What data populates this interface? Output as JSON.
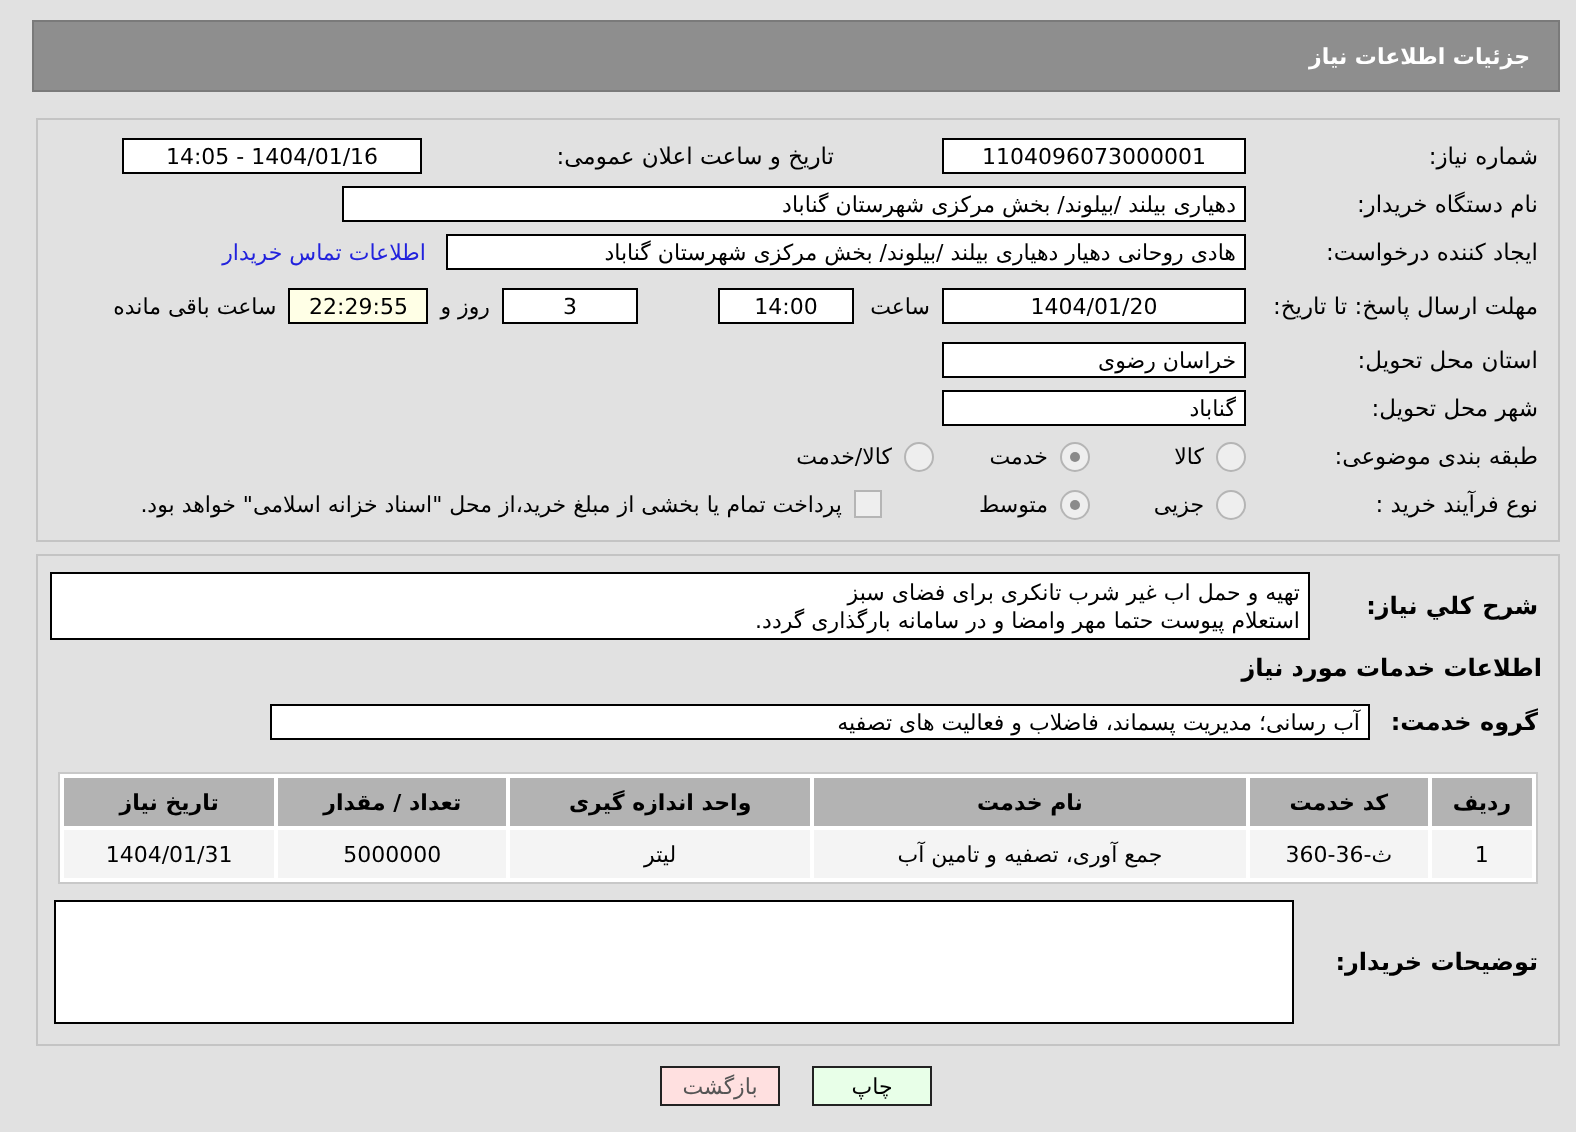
{
  "header": {
    "title": "جزئیات اطلاعات نیاز"
  },
  "need_number": {
    "label": "شماره نیاز:",
    "value": "1104096073000001"
  },
  "announce": {
    "label": "تاریخ و ساعت اعلان عمومی:",
    "value": "1404/01/16 - 14:05"
  },
  "buyer": {
    "label": "نام دستگاه خریدار:",
    "value": "دهیاری بیلند /بیلوند/ بخش مرکزی شهرستان گناباد"
  },
  "creator": {
    "label": "ایجاد کننده درخواست:",
    "value": "هادی روحانی دهیار دهیاری بیلند /بیلوند/ بخش مرکزی شهرستان گناباد",
    "link": "اطلاعات تماس خریدار"
  },
  "deadline": {
    "label": "مهلت ارسال پاسخ: تا تاریخ:",
    "date": "1404/01/20",
    "time_label": "ساعت",
    "time": "14:00",
    "days": "3",
    "days_label": "روز و",
    "remaining": "22:29:55",
    "remaining_label": "ساعت باقی مانده"
  },
  "province": {
    "label": "استان محل تحویل:",
    "value": "خراسان رضوی"
  },
  "city": {
    "label": "شهر محل تحویل:",
    "value": "گناباد"
  },
  "category": {
    "label": "طبقه بندی موضوعی:",
    "options": [
      {
        "label": "کالا",
        "selected": false
      },
      {
        "label": "خدمت",
        "selected": true
      },
      {
        "label": "کالا/خدمت",
        "selected": false
      }
    ]
  },
  "purchase_type": {
    "label": "نوع فرآیند خرید :",
    "options": [
      {
        "label": "جزیی",
        "selected": false
      },
      {
        "label": "متوسط",
        "selected": true
      }
    ],
    "payment": {
      "label": "پرداخت تمام یا بخشی از مبلغ خرید،از محل \"اسناد خزانه اسلامی\" خواهد بود.",
      "checked": false
    }
  },
  "description": {
    "label": "شرح کلي نیاز:",
    "lines": [
      "تهیه و حمل اب غیر شرب تانکری برای فضای سبز",
      "استعلام پیوست حتما مهر وامضا و در سامانه بارگذاری گردد."
    ]
  },
  "services_heading": "اطلاعات خدمات مورد نیاز",
  "service_group": {
    "label": "گروه خدمت:",
    "value": "آب رسانی؛ مدیریت پسماند، فاضلاب و فعالیت های تصفیه"
  },
  "table": {
    "columns": [
      "ردیف",
      "کد خدمت",
      "نام خدمت",
      "واحد اندازه گیری",
      "تعداد / مقدار",
      "تاریخ نیاز"
    ],
    "rows": [
      [
        "1",
        "ث-36-360",
        "جمع آوری، تصفیه و تامین آب",
        "لیتر",
        "5000000",
        "1404/01/31"
      ]
    ]
  },
  "buyer_notes": {
    "label": "توضیحات خریدار:"
  },
  "buttons": [
    {
      "label": "چاپ",
      "kind": "print"
    },
    {
      "label": "بازگشت",
      "kind": "back"
    }
  ]
}
